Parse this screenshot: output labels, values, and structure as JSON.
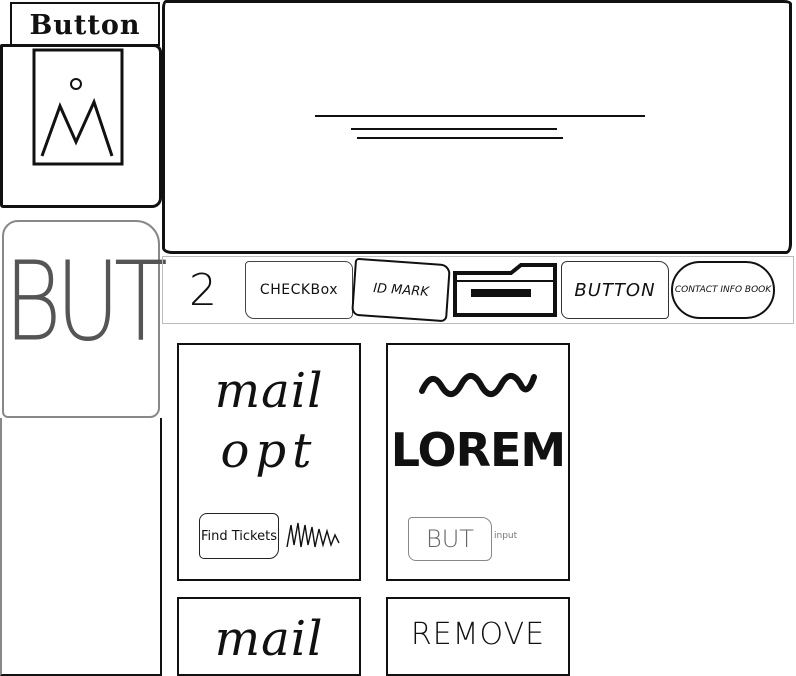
{
  "left": {
    "top_button_label": "Button",
    "big_button_label": "BUT"
  },
  "toolbar": {
    "number": "2",
    "checkbox_label": "CHECKBox",
    "mark_label": "ID MARK",
    "button_label": "BUTTON",
    "contact_label": "CONTACT INFO BOOK"
  },
  "cards": {
    "mail": {
      "title": "mail",
      "subtitle": "opt",
      "find_tickets": "Find Tickets"
    },
    "lorem": {
      "title": "LOREM",
      "button": "BUT",
      "input_label": "input"
    },
    "mail_small": {
      "title": "mail"
    },
    "remove": {
      "title": "REMOVE"
    }
  }
}
